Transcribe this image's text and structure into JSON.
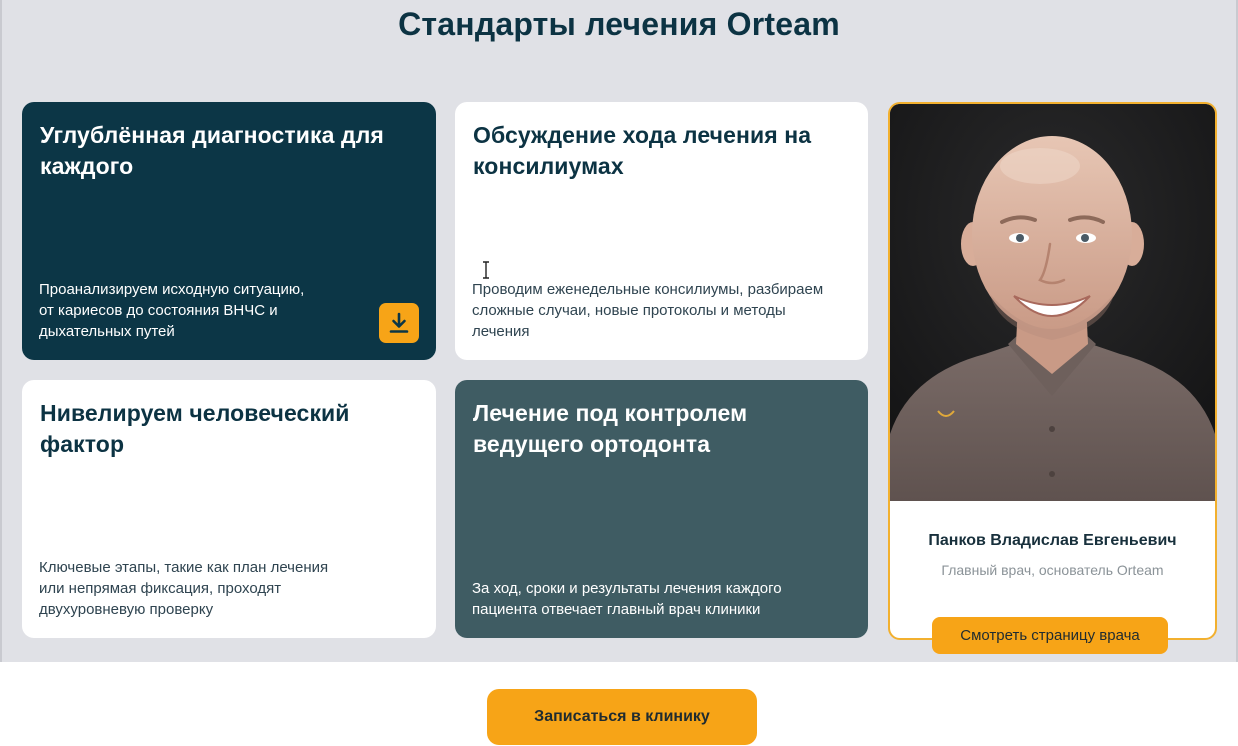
{
  "section": {
    "title": "Стандарты лечения Orteam"
  },
  "cards": [
    {
      "title": "Углублённая диагностика для каждого",
      "text_lines": [
        "Проанализируем исходную ситуацию,",
        "от кариесов до состояния ВНЧС и",
        "дыхательных путей"
      ],
      "action_icon": "download-icon"
    },
    {
      "title": "Обсуждение хода лечения на консилиумах",
      "text_lines": [
        "Проводим еженедельные консилиумы, разбираем",
        "сложные случаи, новые протоколы и методы",
        "лечения"
      ]
    },
    {
      "title": "Нивелируем человеческий фактор",
      "text_lines": [
        "Ключевые этапы, такие как план лечения",
        "или непрямая фиксация, проходят",
        "двухуровневую проверку"
      ]
    },
    {
      "title": "Лечение под контролем ведущего ортодонта",
      "text_lines": [
        "За ход, сроки и результаты лечения каждого",
        "пациента отвечает главный врач клиники"
      ]
    }
  ],
  "doctor": {
    "name": "Панков Владислав Евгеньевич",
    "role": "Главный врач, основатель Orteam",
    "link_label": "Смотреть страницу врача"
  },
  "cta": {
    "label": "Записаться в клинику"
  },
  "colors": {
    "section_bg": "#e0e1e6",
    "dark_card": "#0c3646",
    "teal_card": "#3f5c63",
    "accent": "#f7a417",
    "heading": "#0c3343"
  }
}
